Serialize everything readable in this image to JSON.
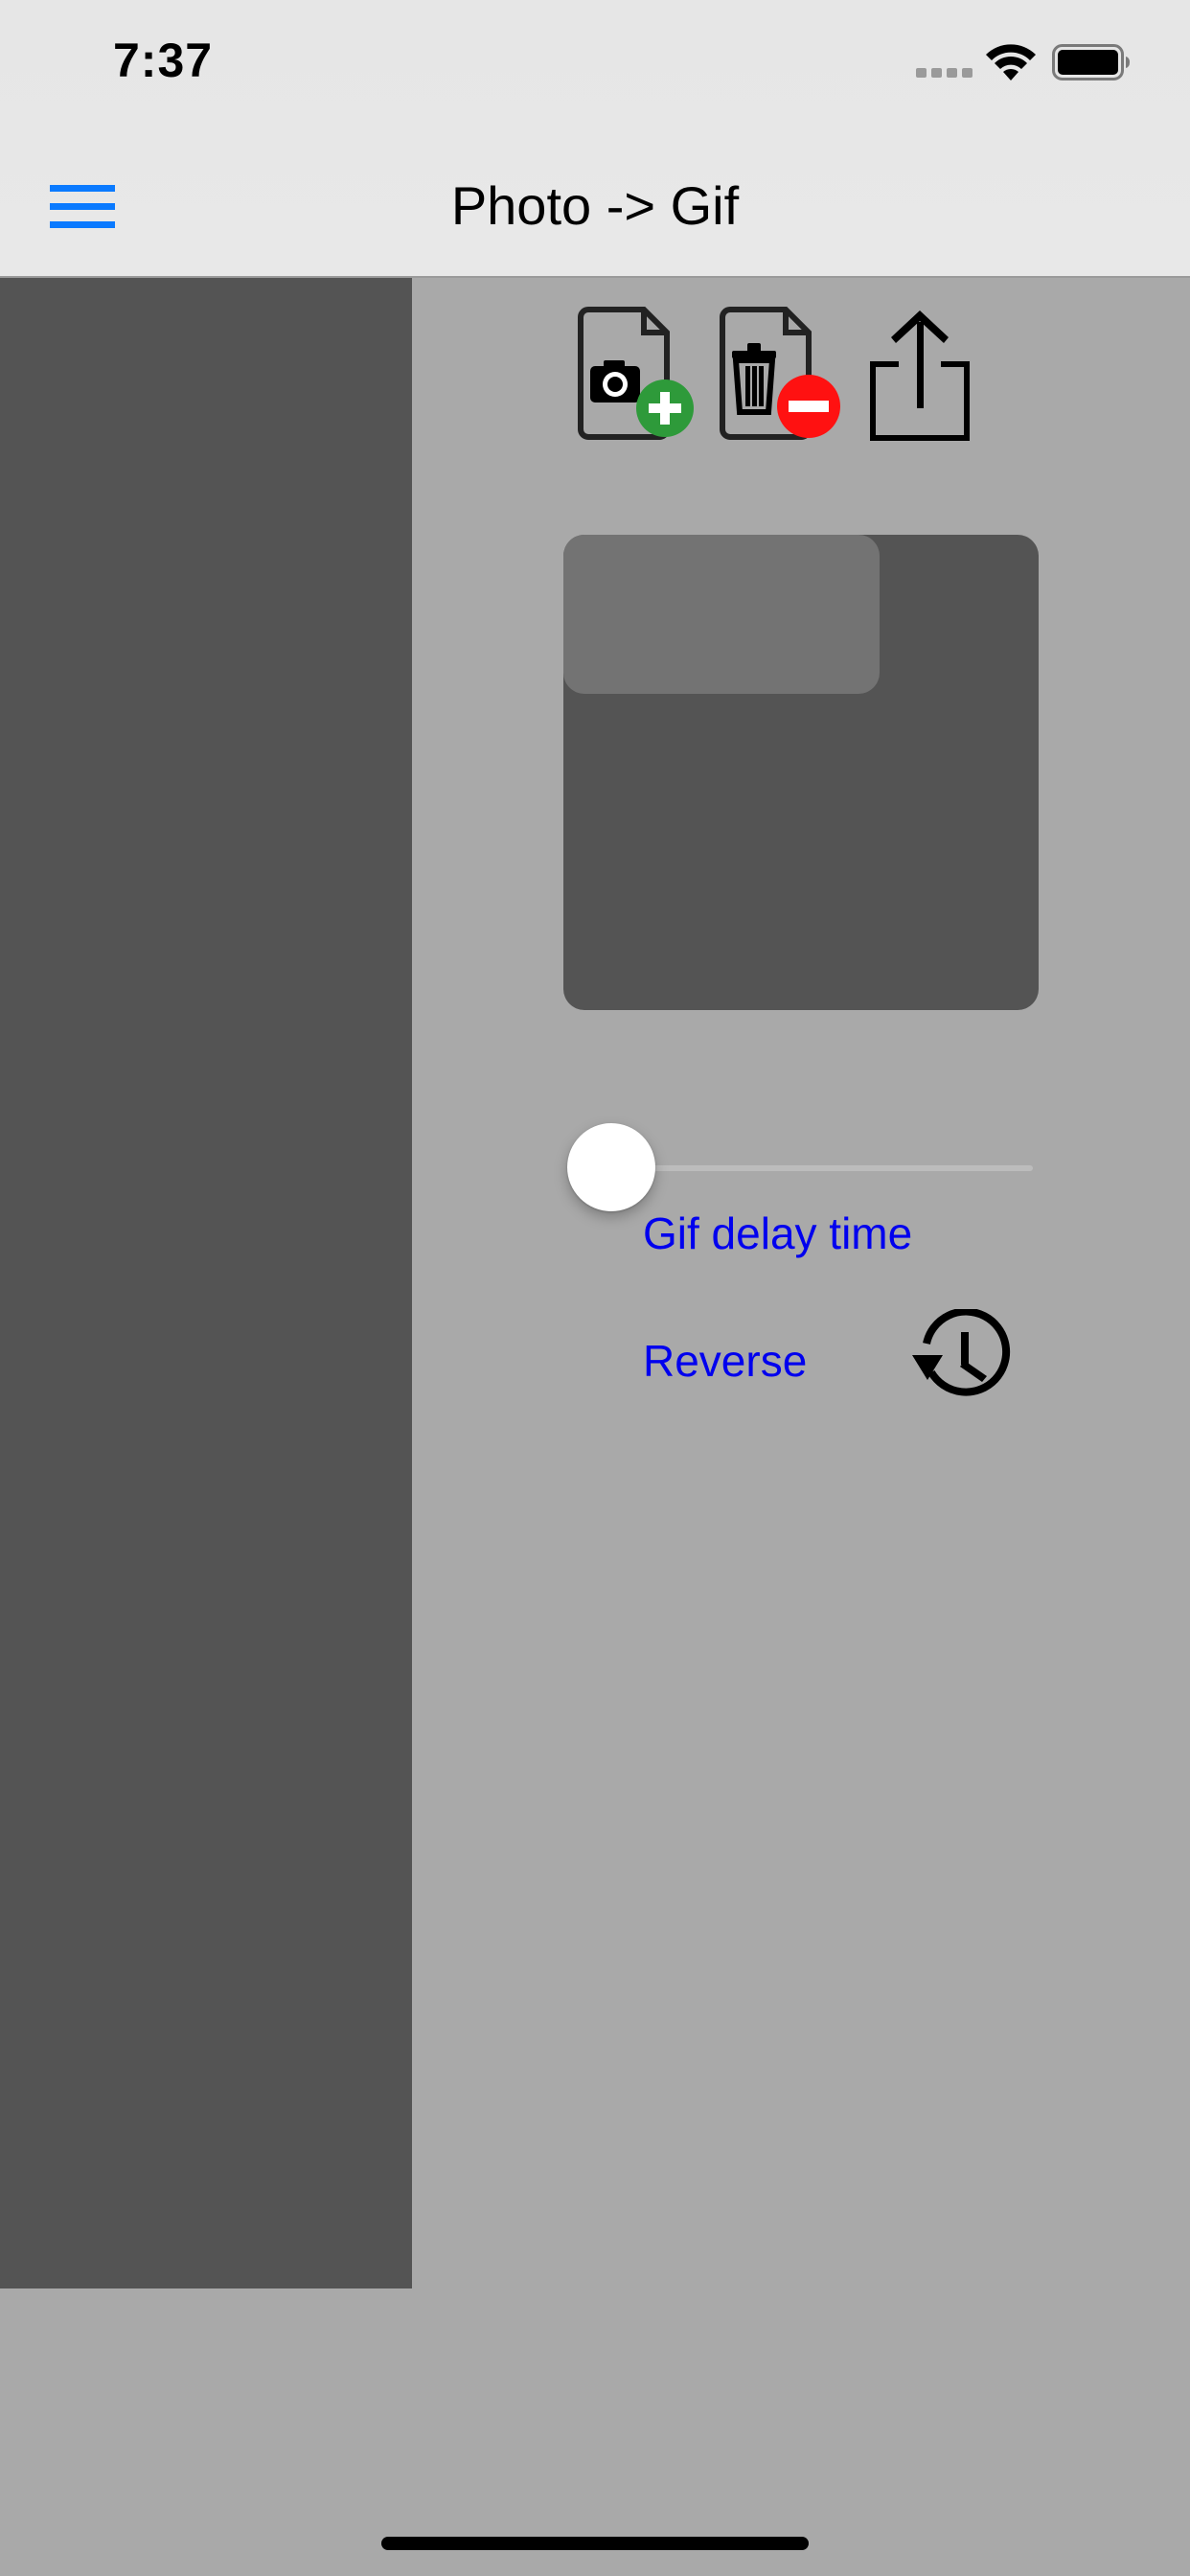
{
  "status_bar": {
    "time": "7:37"
  },
  "nav": {
    "title": "Photo -> Gif"
  },
  "controls": {
    "delay_label": "Gif delay time",
    "reverse_label": "Reverse",
    "delay_slider_value": 0
  },
  "icons": {
    "menu": "hamburger-menu-icon",
    "add_photo": "add-photo-icon",
    "delete_photo": "delete-photo-icon",
    "share": "share-icon",
    "history": "history-icon"
  },
  "colors": {
    "accent_blue": "#0a7aff",
    "link_blue": "#0000ee",
    "add_green": "#2e9a3a",
    "delete_red": "#ff1111",
    "background": "#a9a9a9",
    "panel": "#545454"
  }
}
